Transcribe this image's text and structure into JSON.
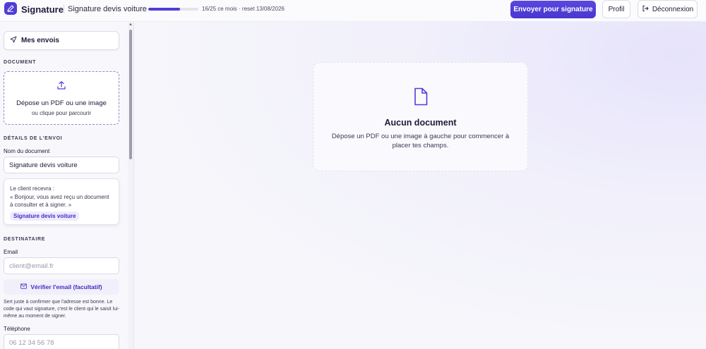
{
  "header": {
    "brand": "Signature",
    "document_title": "Signature devis voiture",
    "quota_text": "16/25 ce mois · reset 13/08/2026",
    "quota_fraction": 0.64,
    "send_label": "Envoyer pour signature",
    "profil_label": "Profil",
    "logout_label": "Déconnexion"
  },
  "sidebar": {
    "mes_envois_label": "Mes envois",
    "document_section": "DOCUMENT",
    "dropzone_title": "Dépose un PDF ou une image",
    "dropzone_sub": "ou clique pour parcourir",
    "details_section": "DÉTAILS DE L'ENVOI",
    "doc_name_label": "Nom du document",
    "doc_name_value": "Signature devis voiture",
    "preview_line1": "Le client recevra :",
    "preview_line2": "« Bonjour, vous avez reçu un document à consulter et à signer. »",
    "preview_pill": "Signature devis voiture",
    "recipient_section": "DESTINATAIRE",
    "email_label": "Email",
    "email_placeholder": "client@email.fr",
    "verify_label": "Vérifier l'email (facultatif)",
    "help_text": "Sert juste à confirmer que l'adresse est bonne. Le code qui vaut signature, c'est le client qui le saisit lui-même au moment de signer.",
    "phone_label": "Téléphone",
    "phone_placeholder": "06 12 34 56 78"
  },
  "main": {
    "empty_title": "Aucun document",
    "empty_text": "Dépose un PDF ou une image à gauche pour commencer à placer tes champs."
  },
  "colors": {
    "accent": "#4f3dd6",
    "background": "#f6f6fb"
  },
  "icons": {
    "logo": "signature-pen-icon",
    "mes_envois": "send-icon",
    "dropzone": "upload-icon",
    "verify": "mail-icon",
    "logout": "logout-icon",
    "empty": "file-icon"
  }
}
